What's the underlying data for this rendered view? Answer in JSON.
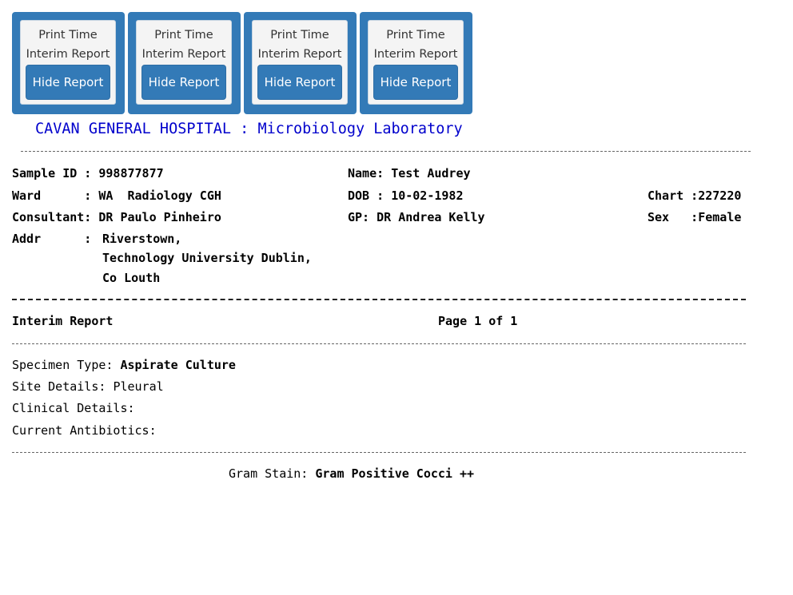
{
  "cards": [
    {
      "print_time": "Print Time",
      "report_type": "Interim Report",
      "button": "Hide Report"
    },
    {
      "print_time": "Print Time",
      "report_type": "Interim Report",
      "button": "Hide Report"
    },
    {
      "print_time": "Print Time",
      "report_type": "Interim Report",
      "button": "Hide Report"
    },
    {
      "print_time": "Print Time",
      "report_type": "Interim Report",
      "button": "Hide Report"
    }
  ],
  "report": {
    "hospital_title": "CAVAN GENERAL HOSPITAL : Microbiology Laboratory",
    "sample_id_label": "Sample ID : ",
    "sample_id": "998877877",
    "name_label": "Name: ",
    "name": "Test Audrey",
    "ward_label": "Ward      : ",
    "ward": "WA  Radiology CGH",
    "dob_label": "DOB : ",
    "dob": "10-02-1982",
    "chart_label": "Chart :",
    "chart": "227220",
    "consultant_label": "Consultant: ",
    "consultant": "DR Paulo Pinheiro",
    "gp_label": "GP: ",
    "gp": "DR Andrea Kelly",
    "sex_label": "Sex   :",
    "sex": "Female",
    "addr_label": "Addr      : ",
    "addr_lines": [
      "Riverstown,",
      "Technology University Dublin,",
      "Co Louth"
    ],
    "report_type": "Interim Report",
    "page_info": "Page 1 of 1",
    "specimen_type_label": "Specimen Type: ",
    "specimen_type": "Aspirate Culture",
    "site_details_label": "Site Details: ",
    "site_details": "Pleural",
    "clinical_details_label": "Clinical Details:",
    "current_antibiotics_label": "Current Antibiotics:",
    "gram_stain_label": "Gram Stain: ",
    "gram_stain": "Gram Positive Cocci ++"
  }
}
